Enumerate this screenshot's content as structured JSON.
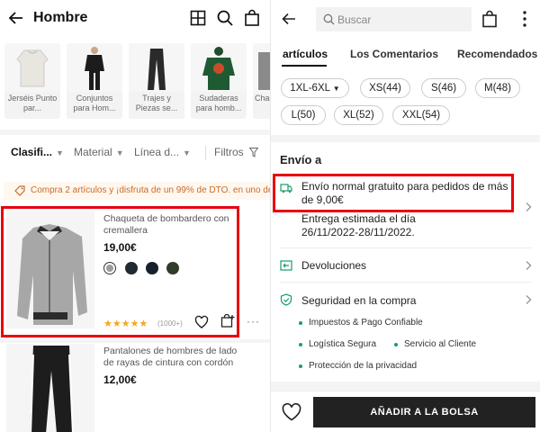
{
  "left": {
    "title": "Hombre",
    "categories": [
      {
        "label": "Jerséis Punto par..."
      },
      {
        "label": "Conjuntos para Hom..."
      },
      {
        "label": "Trajes y Piezas se..."
      },
      {
        "label": "Sudaderas para homb..."
      },
      {
        "label": "Cha & Ab"
      }
    ],
    "filters": {
      "sort": "Clasifi...",
      "material": "Material",
      "line": "Línea d...",
      "filters": "Filtros"
    },
    "promo": "Compra 2 artículos y ¡disfruta de un 99% de DTO. en uno de",
    "products": [
      {
        "name": "Chaqueta de bombardero con cremallera",
        "price": "19,00€",
        "swatches": [
          "#9c9c9c",
          "#1f2a33",
          "#16212b",
          "#2f3c2a"
        ],
        "rating": 5,
        "reviews": "(1000+)"
      },
      {
        "name": "Pantalones de hombres de lado de rayas de cintura con cordón",
        "price": "12,00€"
      }
    ]
  },
  "right": {
    "search_placeholder": "Buscar",
    "tabs": [
      {
        "label": "artículos"
      },
      {
        "label": "Los Comentarios"
      },
      {
        "label": "Recomendados"
      }
    ],
    "sizes": [
      "1XL-6XL",
      "XS(44)",
      "S(46)",
      "M(48)",
      "L(50)",
      "XL(52)",
      "XXL(54)"
    ],
    "shipping": {
      "title": "Envío a",
      "free_shipping": "Envío normal gratuito para pedidos de más de 9,00€",
      "estimate_label": "Entrega estimada el día",
      "estimate_dates": "26/11/2022-28/11/2022."
    },
    "returns": "Devoluciones",
    "security": {
      "title": "Seguridad en la compra",
      "items": [
        "Impuestos & Pago Confiable",
        "Logística Segura",
        "Servicio al Cliente",
        "Protección de la privacidad"
      ]
    },
    "add_to_bag": "AÑADIR A LA BOLSA"
  },
  "colors": {
    "highlight": "#e8000f",
    "promo_text": "#c9692a",
    "star": "#f5a623",
    "security_green": "#1a9c6a",
    "button_bg": "#222222"
  }
}
